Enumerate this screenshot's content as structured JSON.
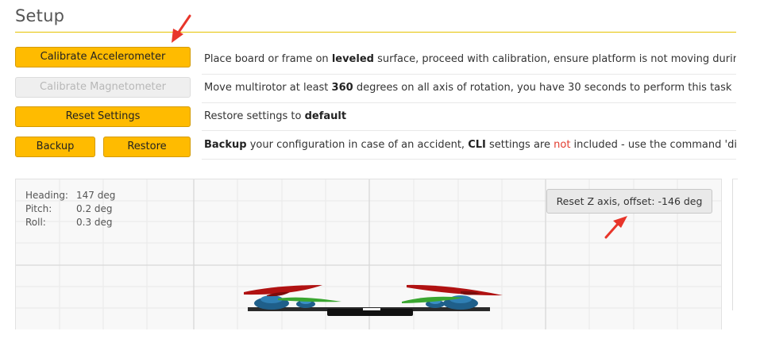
{
  "page": {
    "title": "Setup"
  },
  "actions": {
    "calibrate_accel": {
      "label": "Calibrate Accelerometer",
      "desc_pre": "Place board or frame on ",
      "desc_bold": "leveled",
      "desc_post": " surface, proceed with calibration, ensure platform is not moving during calibra"
    },
    "calibrate_mag": {
      "label": "Calibrate Magnetometer",
      "desc_pre": "Move multirotor at least ",
      "desc_bold": "360",
      "desc_post": " degrees on all axis of rotation, you have 30 seconds to perform this task"
    },
    "reset_settings": {
      "label": "Reset Settings",
      "desc_pre": "Restore settings to ",
      "desc_bold": "default"
    },
    "backup": {
      "backup_label": "Backup",
      "restore_label": "Restore",
      "desc_bold1": "Backup",
      "desc_mid1": " your configuration in case of an accident, ",
      "desc_bold2": "CLI",
      "desc_mid2": " settings are ",
      "desc_red": "not",
      "desc_post": " included - use the command 'diff all' in CL"
    }
  },
  "attitude": {
    "heading_label": "Heading:",
    "heading_value": "147 deg",
    "pitch_label": "Pitch:",
    "pitch_value": "0.2 deg",
    "roll_label": "Roll:",
    "roll_value": "0.3 deg"
  },
  "reset_z": {
    "label": "Reset Z axis, offset: -146 deg"
  },
  "colors": {
    "accent": "#ffbb00",
    "annotation": "#e8352a"
  }
}
